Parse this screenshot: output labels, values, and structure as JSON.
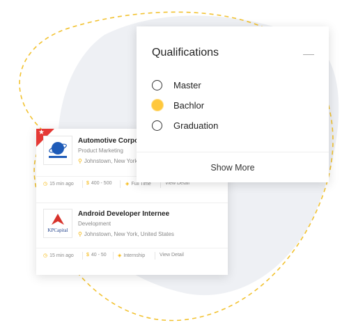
{
  "colors": {
    "accent": "#f5b400",
    "ribbon": "#e53935",
    "blob": "#eef0f4",
    "dash": "#f2c230"
  },
  "jobs": [
    {
      "title": "Automotive Corpor",
      "category": "Product Marketing",
      "location": "Johnstown, New York",
      "logo_text": "AUTOMOTIVE",
      "posted": "15 min ago",
      "salary": "400 - 500",
      "type": "Full Time",
      "action": "View Detail",
      "featured": true
    },
    {
      "title": "Android Developer Internee",
      "category": "Development",
      "location": "Johnstown, New York, United States",
      "logo_text": "KPCapital",
      "posted": "15 min ago",
      "salary": "40 - 50",
      "type": "Internship",
      "action": "View Detail",
      "featured": false
    }
  ],
  "qualifications": {
    "title": "Qualifications",
    "options": [
      {
        "label": "Master",
        "checked": false
      },
      {
        "label": "Bachlor",
        "checked": true
      },
      {
        "label": "Graduation",
        "checked": false
      }
    ],
    "show_more": "Show More"
  }
}
